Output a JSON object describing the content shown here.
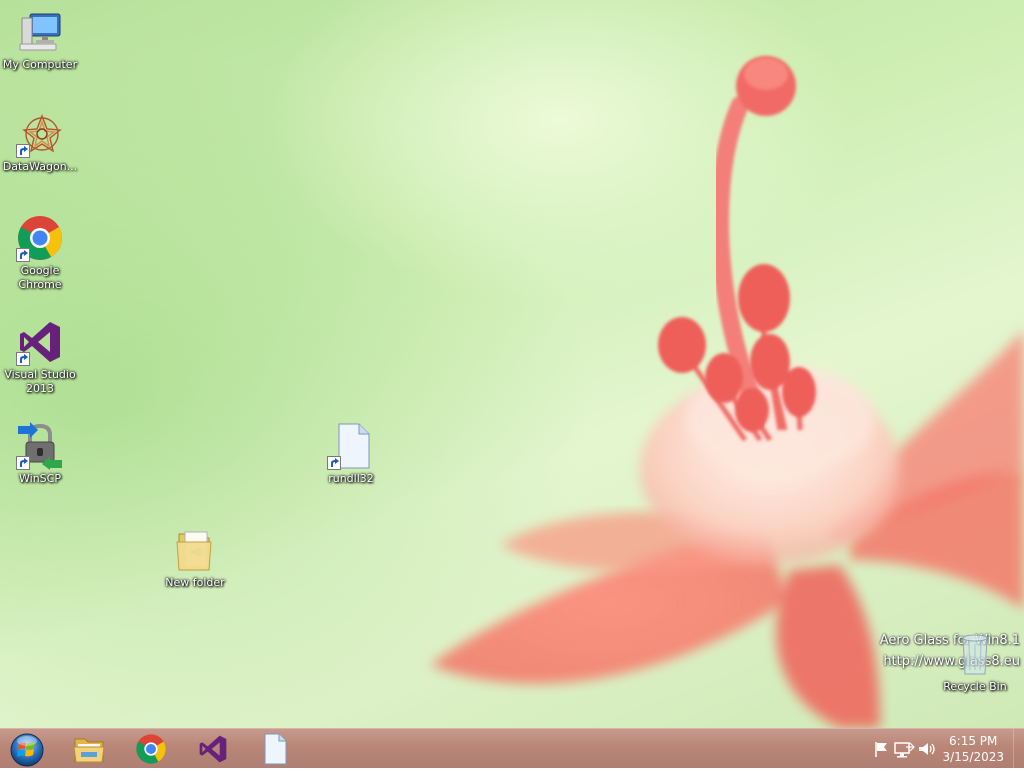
{
  "desktop": {
    "icons": [
      {
        "name": "my-computer",
        "label": "My Computer",
        "shortcut": false
      },
      {
        "name": "datawagon",
        "label": "DataWagon...",
        "shortcut": true
      },
      {
        "name": "google-chrome",
        "label": "Google Chrome",
        "shortcut": true
      },
      {
        "name": "visual-studio-2013",
        "label": "Visual Studio 2013",
        "shortcut": true
      },
      {
        "name": "winscp",
        "label": "WinSCP",
        "shortcut": true
      },
      {
        "name": "rundll32",
        "label": "rundll32",
        "shortcut": true
      },
      {
        "name": "new-folder",
        "label": "New folder",
        "shortcut": false
      },
      {
        "name": "recycle-bin",
        "label": "Recycle Bin",
        "shortcut": false
      }
    ],
    "watermark": {
      "line1": "Aero Glass for Win8.1",
      "line2": "http://www.glass8.eu"
    }
  },
  "taskbar": {
    "start_icon": "windows-orb-icon",
    "pinned": [
      {
        "name": "file-explorer",
        "icon": "folder-icon"
      },
      {
        "name": "google-chrome",
        "icon": "chrome-icon"
      },
      {
        "name": "visual-studio",
        "icon": "visual-studio-icon"
      },
      {
        "name": "document",
        "icon": "blank-document-icon"
      }
    ],
    "tray_icons": [
      "action-center-flag-icon",
      "network-icon",
      "volume-icon"
    ],
    "clock": {
      "time": "6:15 PM",
      "date": "3/15/2023"
    },
    "colors": {
      "taskbar": "#b98677",
      "accent": "#68217a"
    }
  }
}
